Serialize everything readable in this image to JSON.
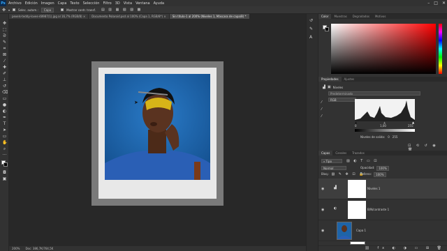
{
  "app": {
    "logo": "Ps"
  },
  "menu": [
    "Archivo",
    "Edición",
    "Imagen",
    "Capa",
    "Texto",
    "Selección",
    "Filtro",
    "3D",
    "Vista",
    "Ventana",
    "Ayuda"
  ],
  "window_controls": [
    "–",
    "□",
    "✕"
  ],
  "options": {
    "auto_select_label": "Selec. autom.:",
    "auto_select_value": "Capa",
    "transform_label": "Mostrar contr. transf."
  },
  "tabs": [
    {
      "label": "pexels-teddy-loves-48987(1).jpg al 16,7% (RGB/8) ×",
      "active": false
    },
    {
      "label": "Documento Polaroid.psd al 100% (Capa 1, RGB/8*) ×",
      "active": false
    },
    {
      "label": "Sin título-1 al 200% (Niveles 1, Máscara de capa/8) *",
      "active": true
    }
  ],
  "status": {
    "zoom": "200%",
    "doc": "Doc: 386,7K/764,5K"
  },
  "panels": {
    "color_tabs": [
      "Color",
      "Muestras",
      "Degradados",
      "Motivos"
    ],
    "properties_tabs": [
      "Propiedades",
      "Ajustes"
    ],
    "properties_title": "Niveles",
    "preset": "Predeterminado",
    "channel": "RGB",
    "input_levels": [
      "0",
      "1,00",
      "255"
    ],
    "output_label": "Niveles de salida:",
    "output_levels": [
      "0",
      "255"
    ],
    "layers_tabs": [
      "Capas",
      "Canales",
      "Trazados"
    ],
    "filter_label": "Tipo",
    "blend_mode": "Normal",
    "opacity_label": "Opacidad:",
    "opacity_value": "100%",
    "lock_label": "Bloq.:",
    "fill_label": "Relleno:",
    "fill_value": "100%"
  },
  "layers": [
    {
      "name": "Niveles 1"
    },
    {
      "name": "B/N/contraste 1"
    },
    {
      "name": "Capa 1"
    }
  ],
  "colors": {
    "accent": "#31a8ff",
    "photo_bg": "#1e64a8",
    "sweater": "#2a5fb5",
    "paint": "#d7b418",
    "skin": "#5a3320",
    "frame": "#7a7a7a",
    "polaroid": "#e8e8e8"
  }
}
